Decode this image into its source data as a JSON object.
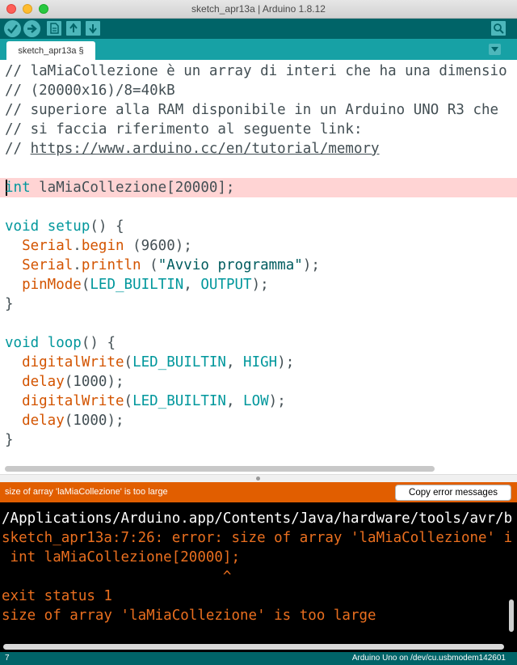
{
  "window": {
    "title": "sketch_apr13a | Arduino 1.8.12"
  },
  "toolbar": {
    "buttons": [
      "verify-icon",
      "upload-icon",
      "new-icon",
      "open-icon",
      "save-icon",
      "serial-monitor-icon"
    ]
  },
  "tab": {
    "label": "sketch_apr13a §"
  },
  "editor": {
    "lines": [
      {
        "segments": [
          {
            "t": "// laMiaCollezione è un array di interi che ha una dimensio",
            "c": "cmt"
          }
        ]
      },
      {
        "segments": [
          {
            "t": "// (20000x16)/8=40kB",
            "c": "cmt"
          }
        ]
      },
      {
        "segments": [
          {
            "t": "// superiore alla RAM disponibile in un Arduino UNO R3 che",
            "c": "cmt"
          }
        ]
      },
      {
        "segments": [
          {
            "t": "// si faccia riferimento al seguente link:",
            "c": "cmt"
          }
        ]
      },
      {
        "segments": [
          {
            "t": "// ",
            "c": "cmt"
          },
          {
            "t": "https://www.arduino.cc/en/tutorial/memory",
            "c": "cmt lnk"
          }
        ]
      },
      {
        "segments": []
      },
      {
        "segments": [
          {
            "t": "int",
            "c": "kw"
          },
          {
            "t": " laMiaCollezione[20000];",
            "c": ""
          }
        ],
        "highlight": true
      },
      {
        "segments": []
      },
      {
        "segments": [
          {
            "t": "void",
            "c": "kw"
          },
          {
            "t": " ",
            "c": ""
          },
          {
            "t": "setup",
            "c": "kw"
          },
          {
            "t": "() {",
            "c": ""
          }
        ]
      },
      {
        "segments": [
          {
            "t": "  ",
            "c": ""
          },
          {
            "t": "Serial",
            "c": "fn"
          },
          {
            "t": ".",
            "c": ""
          },
          {
            "t": "begin",
            "c": "fn"
          },
          {
            "t": " (9600);",
            "c": ""
          }
        ]
      },
      {
        "segments": [
          {
            "t": "  ",
            "c": ""
          },
          {
            "t": "Serial",
            "c": "fn"
          },
          {
            "t": ".",
            "c": ""
          },
          {
            "t": "println",
            "c": "fn"
          },
          {
            "t": " (",
            "c": ""
          },
          {
            "t": "\"Avvio programma\"",
            "c": "str"
          },
          {
            "t": ");",
            "c": ""
          }
        ]
      },
      {
        "segments": [
          {
            "t": "  ",
            "c": ""
          },
          {
            "t": "pinMode",
            "c": "fn"
          },
          {
            "t": "(",
            "c": ""
          },
          {
            "t": "LED_BUILTIN",
            "c": "kw"
          },
          {
            "t": ", ",
            "c": ""
          },
          {
            "t": "OUTPUT",
            "c": "kw"
          },
          {
            "t": ");",
            "c": ""
          }
        ]
      },
      {
        "segments": [
          {
            "t": "}",
            "c": ""
          }
        ]
      },
      {
        "segments": []
      },
      {
        "segments": [
          {
            "t": "void",
            "c": "kw"
          },
          {
            "t": " ",
            "c": ""
          },
          {
            "t": "loop",
            "c": "kw"
          },
          {
            "t": "() {",
            "c": ""
          }
        ]
      },
      {
        "segments": [
          {
            "t": "  ",
            "c": ""
          },
          {
            "t": "digitalWrite",
            "c": "fn"
          },
          {
            "t": "(",
            "c": ""
          },
          {
            "t": "LED_BUILTIN",
            "c": "kw"
          },
          {
            "t": ", ",
            "c": ""
          },
          {
            "t": "HIGH",
            "c": "kw"
          },
          {
            "t": ");",
            "c": ""
          }
        ]
      },
      {
        "segments": [
          {
            "t": "  ",
            "c": ""
          },
          {
            "t": "delay",
            "c": "fn"
          },
          {
            "t": "(1000);",
            "c": ""
          }
        ]
      },
      {
        "segments": [
          {
            "t": "  ",
            "c": ""
          },
          {
            "t": "digitalWrite",
            "c": "fn"
          },
          {
            "t": "(",
            "c": ""
          },
          {
            "t": "LED_BUILTIN",
            "c": "kw"
          },
          {
            "t": ", ",
            "c": ""
          },
          {
            "t": "LOW",
            "c": "kw"
          },
          {
            "t": ");",
            "c": ""
          }
        ]
      },
      {
        "segments": [
          {
            "t": "  ",
            "c": ""
          },
          {
            "t": "delay",
            "c": "fn"
          },
          {
            "t": "(1000);",
            "c": ""
          }
        ]
      },
      {
        "segments": [
          {
            "t": "}",
            "c": ""
          }
        ]
      }
    ]
  },
  "error_bar": {
    "message": "size of array 'laMiaCollezione' is too large",
    "copy_button": "Copy error messages"
  },
  "console": {
    "lines": [
      {
        "text": "/Applications/Arduino.app/Contents/Java/hardware/tools/avr/b",
        "color": "white"
      },
      {
        "text": "sketch_apr13a:7:26: error: size of array 'laMiaCollezione' i",
        "color": "orange"
      },
      {
        "text": " int laMiaCollezione[20000];",
        "color": "orange"
      },
      {
        "text": "                          ^",
        "color": "orange"
      },
      {
        "text": "exit status 1",
        "color": "orange"
      },
      {
        "text": "size of array 'laMiaCollezione' is too large",
        "color": "orange"
      }
    ]
  },
  "status": {
    "line_number": "7",
    "board": "Arduino Uno on /dev/cu.usbmodem142601"
  },
  "colors": {
    "toolbar": "#006468",
    "tab_bar": "#17a1a5",
    "error_bar": "#e15e00",
    "highlight_line": "#ffd4d4",
    "console_error_text": "#ea6f1f"
  }
}
